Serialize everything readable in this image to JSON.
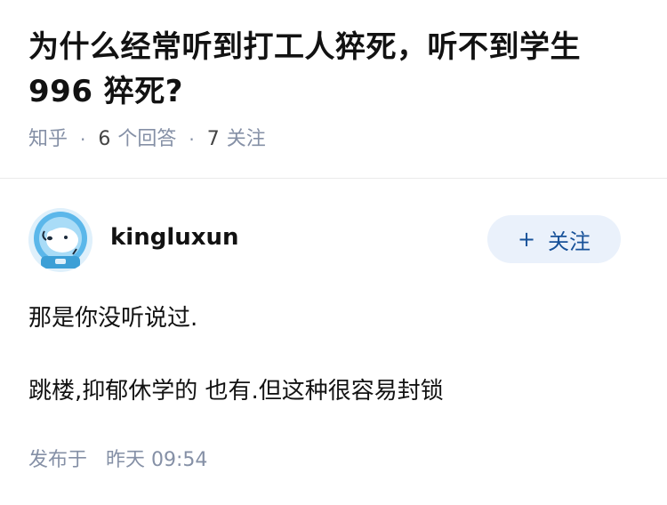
{
  "question": {
    "title": "为什么经常听到打工人猝死，听不到学生996 猝死?",
    "source": "知乎",
    "answer_count": "6",
    "answer_label": "个回答",
    "follower_count": "7",
    "follower_label": "关注",
    "separator": "·"
  },
  "answer": {
    "author_name": "kingluxun",
    "avatar_icon": "astronaut-dog-avatar",
    "follow_button": {
      "plus": "+",
      "label": "关注"
    },
    "paragraphs": [
      "那是你没听说过.",
      "跳楼,抑郁休学的 也有.但这种很容易封锁"
    ],
    "time_prefix": "发布于",
    "time_value": "昨天 09:54"
  },
  "colors": {
    "title": "#121212",
    "meta": "#8590a6",
    "follow_bg": "#eaf1fb",
    "follow_text": "#175199",
    "divider": "#ebebeb"
  }
}
